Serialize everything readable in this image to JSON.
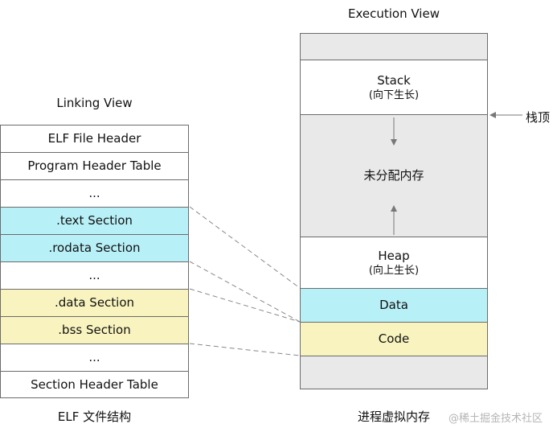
{
  "linking": {
    "title": "Linking View",
    "caption": "ELF 文件结构",
    "rows": [
      {
        "label": "ELF File Header",
        "color": "white"
      },
      {
        "label": "Program Header Table",
        "color": "white"
      },
      {
        "label": "...",
        "color": "white"
      },
      {
        "label": ".text Section",
        "color": "cyan"
      },
      {
        "label": ".rodata Section",
        "color": "cyan"
      },
      {
        "label": "...",
        "color": "white"
      },
      {
        "label": ".data Section",
        "color": "yellow"
      },
      {
        "label": ".bss Section",
        "color": "yellow"
      },
      {
        "label": "...",
        "color": "white"
      },
      {
        "label": "Section Header Table",
        "color": "white"
      }
    ]
  },
  "execution": {
    "title": "Execution View",
    "caption": "进程虚拟内存",
    "stack": {
      "label": "Stack",
      "sub": "(向下生长)"
    },
    "unallocated": {
      "label": "未分配内存"
    },
    "heap": {
      "label": "Heap",
      "sub": "(向上生长)"
    },
    "data": {
      "label": "Data"
    },
    "code": {
      "label": "Code"
    },
    "stack_top_label": "栈顶"
  },
  "watermark": "@稀土掘金技术社区",
  "colors": {
    "cyan": "#b8f0f7",
    "yellow": "#f9f4bf",
    "gray": "#e9e9e9",
    "border": "#6b6b6b"
  }
}
